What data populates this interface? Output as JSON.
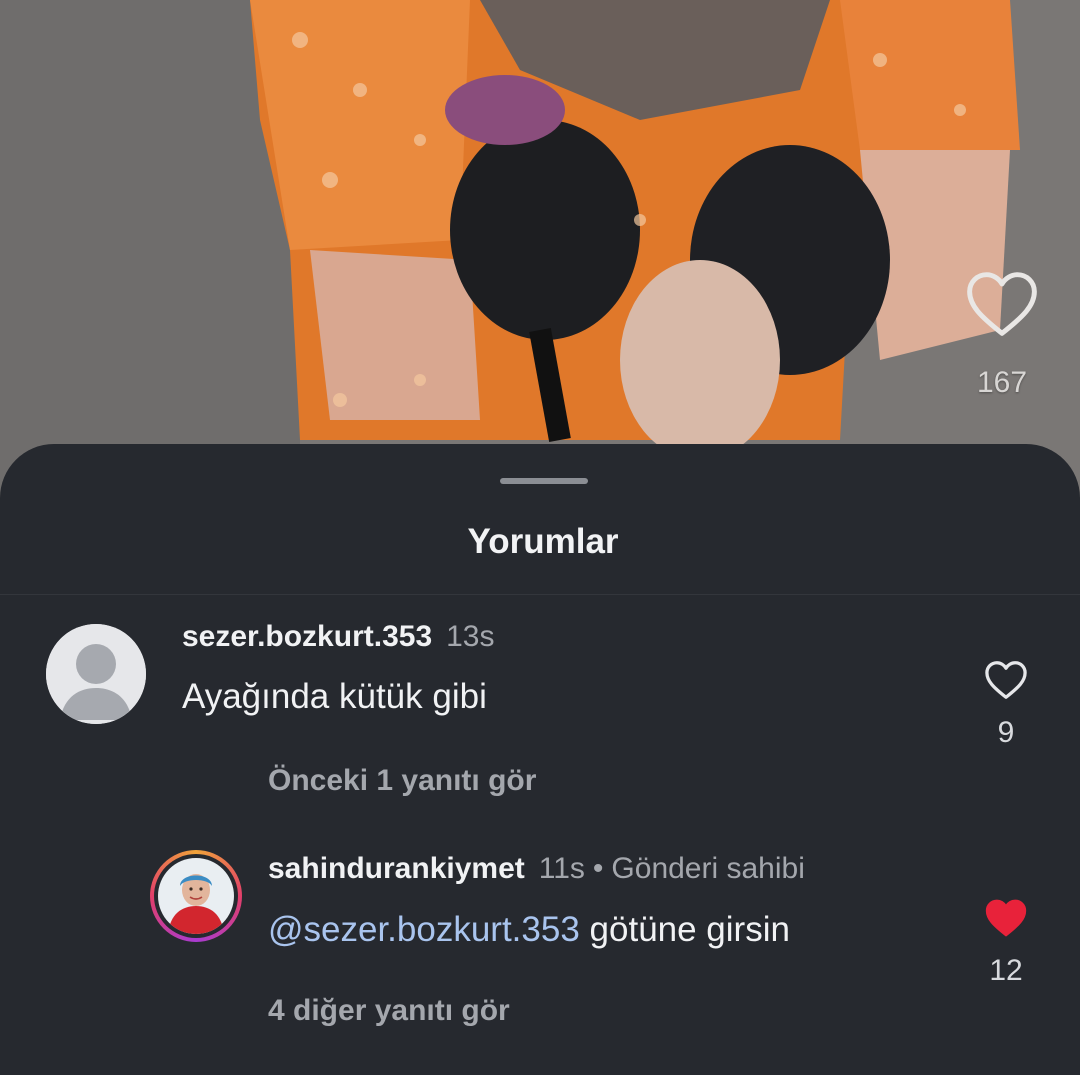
{
  "video": {
    "like_count": "167"
  },
  "sheet": {
    "title": "Yorumlar"
  },
  "comments": [
    {
      "username": "sezer.bozkurt.353",
      "time": "13s",
      "text": "Ayağında kütük gibi",
      "like_count": "9",
      "liked": false,
      "replies_link": "Önceki 1 yanıtı gör"
    },
    {
      "username": "sahindurankiymet",
      "time": "11s",
      "separator": "•",
      "owner_label": "Gönderi sahibi",
      "mention": "@sezer.bozkurt.353",
      "text": " götüne girsin",
      "like_count": "12",
      "liked": true,
      "replies_link": "4 diğer yanıtı gör"
    }
  ],
  "colors": {
    "sheet_bg": "#26292f",
    "liked_heart": "#e8223a",
    "mention": "#a9c4ee"
  },
  "icons": {
    "video_like": "heart-outline-icon",
    "comment_like": "heart-outline-icon",
    "comment_liked": "heart-filled-icon",
    "default_avatar": "person-placeholder-icon"
  }
}
